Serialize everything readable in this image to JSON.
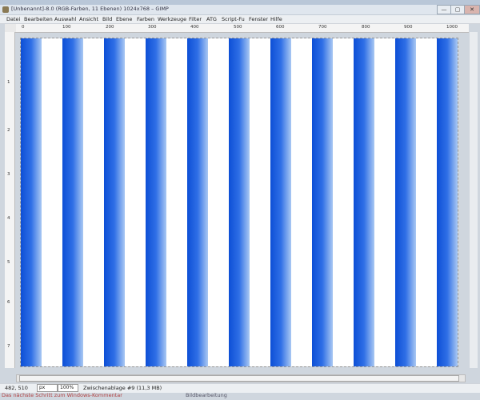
{
  "window": {
    "title": "[Unbenannt]-8.0 (RGB-Farben, 11 Ebenen) 1024x768 – GIMP",
    "controls": {
      "min": "—",
      "max": "▢",
      "close": "✕"
    }
  },
  "menu": [
    "Datei",
    "Bearbeiten",
    "Auswahl",
    "Ansicht",
    "Bild",
    "Ebene",
    "Farben",
    "Werkzeuge",
    "Filter",
    "ATG",
    "Script-Fu",
    "Fenster",
    "Hilfe"
  ],
  "ruler": {
    "top_labels": [
      "0",
      "100",
      "200",
      "300",
      "400",
      "500",
      "600",
      "700",
      "800",
      "900",
      "1000"
    ],
    "left_labels": [
      "1",
      "2",
      "3",
      "4",
      "5",
      "6",
      "7"
    ]
  },
  "canvas": {
    "stripe_count": 11,
    "stripe_gradient": [
      "#0d4fd6",
      "#2f6fe6",
      "#a9c8f3"
    ],
    "background": "#ffffff"
  },
  "status": {
    "coordinates": "482, 510",
    "unit": "px",
    "zoom": "100%",
    "layer_info": "Zwischenablage #9 (11,3 MB)"
  },
  "footer": {
    "text": "Das nächste Schritt zum Windows-Kommentar",
    "right_text": "Bildbearbeitung"
  }
}
